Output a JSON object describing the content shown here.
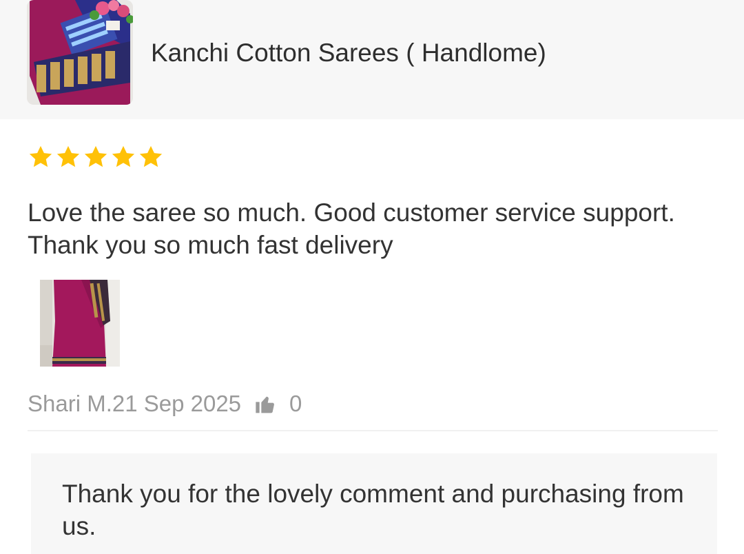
{
  "product": {
    "title": "Kanchi Cotton Sarees ( Handlome)",
    "thumbnail_icon": "saree-product-photo"
  },
  "review": {
    "rating": 5,
    "rating_max": 5,
    "star_color": "#FFC107",
    "text": "Love the saree so much. Good customer service support. Thank you so much fast delivery",
    "photo_icon": "customer-saree-photo",
    "author_date": "Shari M.21 Sep 2025",
    "like_icon": "thumbs-up-icon",
    "like_count": "0"
  },
  "seller_reply": {
    "text": "Thank you for the lovely comment and purchasing from us."
  }
}
